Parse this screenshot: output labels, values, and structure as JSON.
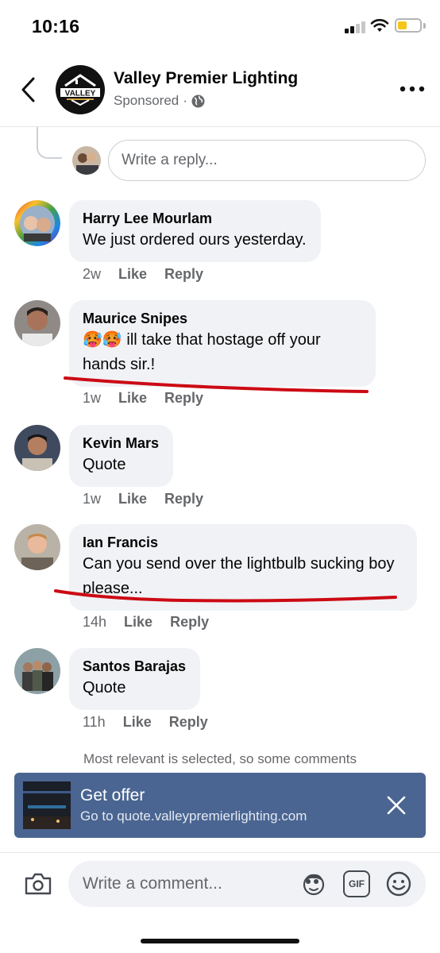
{
  "status_bar": {
    "time": "10:16"
  },
  "header": {
    "page_name": "Valley Premier Lighting",
    "sponsored": "Sponsored",
    "separator": "·",
    "logo_text": "VALLEY"
  },
  "reply": {
    "placeholder": "Write a reply..."
  },
  "comments": [
    {
      "author": "Harry Lee Mourlam",
      "text": "We just ordered ours yesterday.",
      "time": "2w",
      "like": "Like",
      "reply": "Reply"
    },
    {
      "author": "Maurice Snipes",
      "emoji": "🥵🥵",
      "text": "ill take that hostage off your hands sir.!",
      "time": "1w",
      "like": "Like",
      "reply": "Reply"
    },
    {
      "author": "Kevin Mars",
      "text": "Quote",
      "time": "1w",
      "like": "Like",
      "reply": "Reply"
    },
    {
      "author": "Ian Francis",
      "text": "Can you send over the lightbulb sucking boy please...",
      "time": "14h",
      "like": "Like",
      "reply": "Reply"
    },
    {
      "author": "Santos Barajas",
      "text": "Quote",
      "time": "11h",
      "like": "Like",
      "reply": "Reply"
    }
  ],
  "notice": "Most relevant is selected, so some comments",
  "cta": {
    "title": "Get offer",
    "url": "Go to quote.valleypremierlighting.com"
  },
  "composer": {
    "placeholder": "Write a comment...",
    "gif_label": "GIF"
  },
  "colors": {
    "facebook_grey_bubble": "#f0f2f5",
    "cta_background": "#4a6591",
    "annotation_red": "#cc0a14",
    "battery": "#f5c518"
  }
}
